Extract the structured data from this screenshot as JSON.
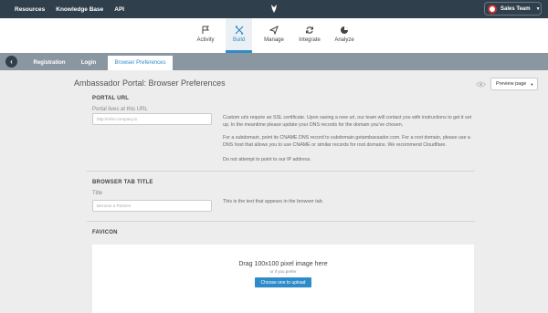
{
  "topbar": {
    "nav": [
      "Resources",
      "Knowledge Base",
      "API"
    ],
    "team": "Sales Team"
  },
  "mainnav": {
    "items": [
      {
        "label": "Activity",
        "icon": "flag-icon"
      },
      {
        "label": "Build",
        "icon": "tools-icon"
      },
      {
        "label": "Manage",
        "icon": "send-icon"
      },
      {
        "label": "Integrate",
        "icon": "sync-icon"
      },
      {
        "label": "Analyze",
        "icon": "pie-chart-icon"
      }
    ],
    "active": "Build",
    "accent": "#2e8bc9"
  },
  "subnav": {
    "tabs": [
      "Registration",
      "Login",
      "Browser Preferences"
    ],
    "active": "Browser Preferences"
  },
  "page": {
    "title": "Ambassador Portal: Browser Preferences",
    "preview_label": "Preview page"
  },
  "portal_url": {
    "heading": "PORTAL URL",
    "label": "Portal lives at this URL",
    "placeholder": "http://refer.company.io",
    "help1": "Custom urls require an SSL certificate. Upon saving a new url, our team will contact you with instructions to get it set up. In the meantime please update your DNS records for the domain you've chosen.",
    "help2": "For a subdomain, point its CNAME DNS record to subdomain.getambassador.com. For a root domain, please use a DNS host that allows you to use CNAME or similar records for root domains. We recommend Cloudflare.",
    "help3": "Do not attempt to point to our IP address."
  },
  "browser_tab": {
    "heading": "BROWSER TAB TITLE",
    "label": "Title",
    "placeholder": "Become a Partner!",
    "help": "This is the text that appears in the browser tab."
  },
  "favicon": {
    "heading": "FAVICON",
    "drag_text": "Drag 100x100 pixel image here",
    "or_text": "or if you prefer",
    "button": "Choose one to upload"
  }
}
